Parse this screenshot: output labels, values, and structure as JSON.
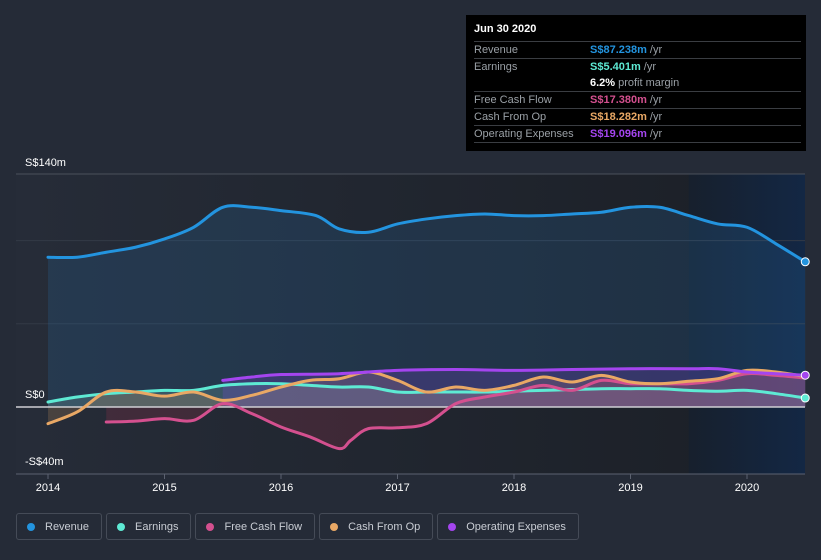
{
  "chart_data": {
    "type": "area",
    "title": "",
    "xlabel": "",
    "ylabel": "",
    "currency_prefix": "S$",
    "ylim": [
      -40,
      140
    ],
    "y_ticks": [
      {
        "value": 140,
        "label": "S$140m"
      },
      {
        "value": 0,
        "label": "S$0"
      },
      {
        "value": -40,
        "label": "-S$40m"
      }
    ],
    "x_range": [
      2013.85,
      2020.5
    ],
    "x_ticks": [
      {
        "value": 2014,
        "label": "2014"
      },
      {
        "value": 2015,
        "label": "2015"
      },
      {
        "value": 2016,
        "label": "2016"
      },
      {
        "value": 2017,
        "label": "2017"
      },
      {
        "value": 2018,
        "label": "2018"
      },
      {
        "value": 2019,
        "label": "2019"
      },
      {
        "value": 2020,
        "label": "2020"
      }
    ],
    "grid": true,
    "highlight_from": 2019.5,
    "series": [
      {
        "name": "Revenue",
        "color": "#2394df",
        "points": [
          [
            2014.0,
            90
          ],
          [
            2014.25,
            90
          ],
          [
            2014.5,
            93
          ],
          [
            2014.75,
            96
          ],
          [
            2015.0,
            101
          ],
          [
            2015.25,
            108
          ],
          [
            2015.5,
            120
          ],
          [
            2015.75,
            120
          ],
          [
            2016.0,
            118
          ],
          [
            2016.3,
            115
          ],
          [
            2016.5,
            107
          ],
          [
            2016.75,
            105
          ],
          [
            2017.0,
            110
          ],
          [
            2017.25,
            113
          ],
          [
            2017.5,
            115
          ],
          [
            2017.75,
            116
          ],
          [
            2018.0,
            115
          ],
          [
            2018.25,
            115
          ],
          [
            2018.5,
            116
          ],
          [
            2018.75,
            117
          ],
          [
            2019.0,
            120
          ],
          [
            2019.25,
            120
          ],
          [
            2019.5,
            115
          ],
          [
            2019.75,
            110
          ],
          [
            2020.0,
            108
          ],
          [
            2020.25,
            98
          ],
          [
            2020.5,
            87.238
          ]
        ]
      },
      {
        "name": "Earnings",
        "color": "#5eead4",
        "points": [
          [
            2014.0,
            3
          ],
          [
            2014.25,
            6
          ],
          [
            2014.5,
            8
          ],
          [
            2014.75,
            9
          ],
          [
            2015.0,
            10
          ],
          [
            2015.25,
            10
          ],
          [
            2015.5,
            13
          ],
          [
            2015.75,
            14
          ],
          [
            2016.0,
            14
          ],
          [
            2016.25,
            13
          ],
          [
            2016.5,
            12
          ],
          [
            2016.75,
            12
          ],
          [
            2017.0,
            9
          ],
          [
            2017.25,
            9
          ],
          [
            2017.5,
            9
          ],
          [
            2017.75,
            9
          ],
          [
            2018.0,
            9.5
          ],
          [
            2018.25,
            10
          ],
          [
            2018.5,
            10.5
          ],
          [
            2018.75,
            11
          ],
          [
            2019.0,
            11
          ],
          [
            2019.25,
            11
          ],
          [
            2019.5,
            10
          ],
          [
            2019.75,
            9.5
          ],
          [
            2020.0,
            10
          ],
          [
            2020.25,
            8
          ],
          [
            2020.5,
            5.401
          ]
        ]
      },
      {
        "name": "Free Cash Flow",
        "color": "#d4508f",
        "points": [
          [
            2014.5,
            -9
          ],
          [
            2014.75,
            -8.5
          ],
          [
            2015.0,
            -7
          ],
          [
            2015.25,
            -8
          ],
          [
            2015.5,
            2
          ],
          [
            2015.75,
            -4
          ],
          [
            2016.0,
            -12
          ],
          [
            2016.25,
            -18
          ],
          [
            2016.5,
            -25
          ],
          [
            2016.6,
            -20
          ],
          [
            2016.75,
            -13
          ],
          [
            2017.0,
            -12.5
          ],
          [
            2017.25,
            -10
          ],
          [
            2017.5,
            2
          ],
          [
            2017.75,
            6
          ],
          [
            2018.0,
            9
          ],
          [
            2018.25,
            13
          ],
          [
            2018.5,
            10
          ],
          [
            2018.75,
            16
          ],
          [
            2019.0,
            14
          ],
          [
            2019.25,
            14
          ],
          [
            2019.5,
            14
          ],
          [
            2019.75,
            16
          ],
          [
            2020.0,
            20
          ],
          [
            2020.25,
            19
          ],
          [
            2020.5,
            17.38
          ]
        ]
      },
      {
        "name": "Cash From Op",
        "color": "#e9a865",
        "points": [
          [
            2014.0,
            -10
          ],
          [
            2014.25,
            -3
          ],
          [
            2014.5,
            9
          ],
          [
            2014.75,
            9
          ],
          [
            2015.0,
            6.5
          ],
          [
            2015.25,
            9
          ],
          [
            2015.5,
            4
          ],
          [
            2015.75,
            7
          ],
          [
            2016.0,
            12
          ],
          [
            2016.25,
            16
          ],
          [
            2016.5,
            17
          ],
          [
            2016.75,
            21
          ],
          [
            2017.0,
            16
          ],
          [
            2017.25,
            9
          ],
          [
            2017.5,
            12
          ],
          [
            2017.75,
            10
          ],
          [
            2018.0,
            13
          ],
          [
            2018.25,
            18
          ],
          [
            2018.5,
            15
          ],
          [
            2018.75,
            19
          ],
          [
            2019.0,
            15
          ],
          [
            2019.25,
            14
          ],
          [
            2019.5,
            15.5
          ],
          [
            2019.75,
            17
          ],
          [
            2020.0,
            22
          ],
          [
            2020.25,
            21
          ],
          [
            2020.5,
            18.282
          ]
        ]
      },
      {
        "name": "Operating Expenses",
        "color": "#a445ef",
        "points": [
          [
            2015.5,
            16
          ],
          [
            2015.75,
            18
          ],
          [
            2016.0,
            19.5
          ],
          [
            2016.5,
            20
          ],
          [
            2017.0,
            22
          ],
          [
            2017.5,
            22.5
          ],
          [
            2018.0,
            22
          ],
          [
            2018.5,
            22.5
          ],
          [
            2019.0,
            23
          ],
          [
            2019.5,
            23
          ],
          [
            2019.75,
            23
          ],
          [
            2020.0,
            21
          ],
          [
            2020.25,
            20
          ],
          [
            2020.5,
            19.096
          ]
        ]
      }
    ]
  },
  "tooltip": {
    "date": "Jun 30 2020",
    "rows": [
      {
        "label": "Revenue",
        "value": "S$87.238m",
        "unit": "/yr",
        "color": "#2394df"
      },
      {
        "label": "Earnings",
        "value": "S$5.401m",
        "unit": "/yr",
        "color": "#5eead4"
      },
      {
        "label": "",
        "value": "6.2%",
        "unit": "profit margin",
        "color": "#ffffff"
      },
      {
        "label": "Free Cash Flow",
        "value": "S$17.380m",
        "unit": "/yr",
        "color": "#d4508f"
      },
      {
        "label": "Cash From Op",
        "value": "S$18.282m",
        "unit": "/yr",
        "color": "#e9a865"
      },
      {
        "label": "Operating Expenses",
        "value": "S$19.096m",
        "unit": "/yr",
        "color": "#a445ef"
      }
    ]
  },
  "legend": [
    {
      "label": "Revenue",
      "color": "#2394df"
    },
    {
      "label": "Earnings",
      "color": "#5eead4"
    },
    {
      "label": "Free Cash Flow",
      "color": "#d4508f"
    },
    {
      "label": "Cash From Op",
      "color": "#e9a865"
    },
    {
      "label": "Operating Expenses",
      "color": "#a445ef"
    }
  ]
}
